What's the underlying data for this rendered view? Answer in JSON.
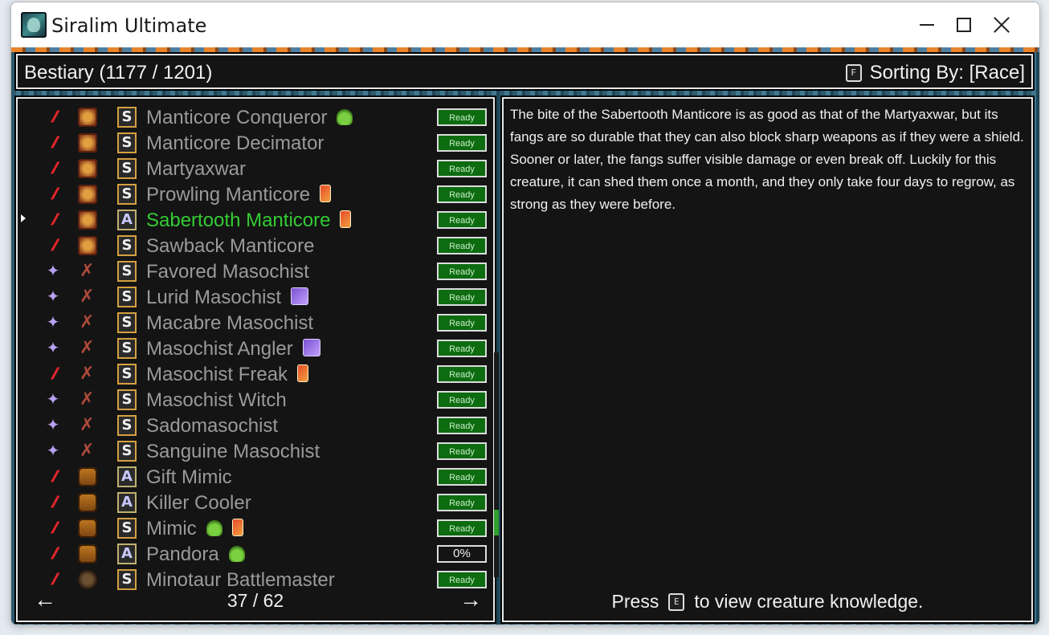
{
  "window": {
    "title": "Siralim Ultimate"
  },
  "header": {
    "title": "Bestiary (1177 / 1201)",
    "sort_key": "F",
    "sort_label": "Sorting By: [Race]"
  },
  "creatures": [
    {
      "class": "chaos",
      "race": "manticore",
      "rank": "S",
      "name": "Manticore Conqueror",
      "badge": "slime",
      "status": "Ready"
    },
    {
      "class": "chaos",
      "race": "manticore",
      "rank": "S",
      "name": "Manticore Decimator",
      "badge": "",
      "status": "Ready"
    },
    {
      "class": "chaos",
      "race": "manticore",
      "rank": "S",
      "name": "Martyaxwar",
      "badge": "",
      "status": "Ready"
    },
    {
      "class": "chaos",
      "race": "manticore",
      "rank": "S",
      "name": "Prowling Manticore",
      "badge": "card",
      "status": "Ready"
    },
    {
      "class": "chaos",
      "race": "manticore",
      "rank": "A",
      "name": "Sabertooth Manticore",
      "badge": "card",
      "status": "Ready",
      "selected": true
    },
    {
      "class": "chaos",
      "race": "manticore",
      "rank": "S",
      "name": "Sawback Manticore",
      "badge": "",
      "status": "Ready"
    },
    {
      "class": "sorcery",
      "race": "masochist",
      "rank": "S",
      "name": "Favored Masochist",
      "badge": "",
      "status": "Ready"
    },
    {
      "class": "sorcery",
      "race": "masochist",
      "rank": "S",
      "name": "Lurid Masochist",
      "badge": "gem",
      "status": "Ready"
    },
    {
      "class": "sorcery",
      "race": "masochist",
      "rank": "S",
      "name": "Macabre Masochist",
      "badge": "",
      "status": "Ready"
    },
    {
      "class": "sorcery",
      "race": "masochist",
      "rank": "S",
      "name": "Masochist Angler",
      "badge": "gem",
      "status": "Ready"
    },
    {
      "class": "chaos",
      "race": "masochist",
      "rank": "S",
      "name": "Masochist Freak",
      "badge": "card",
      "status": "Ready"
    },
    {
      "class": "sorcery",
      "race": "masochist",
      "rank": "S",
      "name": "Masochist Witch",
      "badge": "",
      "status": "Ready"
    },
    {
      "class": "sorcery",
      "race": "masochist",
      "rank": "S",
      "name": "Sadomasochist",
      "badge": "",
      "status": "Ready"
    },
    {
      "class": "sorcery",
      "race": "masochist",
      "rank": "S",
      "name": "Sanguine Masochist",
      "badge": "",
      "status": "Ready"
    },
    {
      "class": "chaos",
      "race": "mimic",
      "rank": "A",
      "name": "Gift Mimic",
      "badge": "",
      "status": "Ready"
    },
    {
      "class": "chaos",
      "race": "mimic",
      "rank": "A",
      "name": "Killer Cooler",
      "badge": "",
      "status": "Ready"
    },
    {
      "class": "chaos",
      "race": "mimic",
      "rank": "S",
      "name": "Mimic",
      "badge": "slime+card",
      "status": "Ready"
    },
    {
      "class": "chaos",
      "race": "mimic",
      "rank": "A",
      "name": "Pandora",
      "badge": "slime",
      "status": "0%"
    },
    {
      "class": "chaos",
      "race": "minotaur",
      "rank": "S",
      "name": "Minotaur Battlemaster",
      "badge": "",
      "status": "Ready"
    }
  ],
  "pager": {
    "prev": "←",
    "next": "→",
    "label": "37 / 62"
  },
  "description": "The bite of the Sabertooth Manticore is as good as that of the Martyaxwar, but its fangs are so durable that they can also block sharp weapons as if they were a shield. Sooner or later, the fangs suffer visible damage or even break off. Luckily for this creature, it can shed them once a month, and they only take four days to regrow, as strong as they were before.",
  "footer": {
    "press": "Press",
    "key": "E",
    "action": "to view creature knowledge."
  },
  "colors": {
    "selected": "#33cc33",
    "ready_bg": "#0d6b10",
    "panel_bg": "#141414"
  }
}
